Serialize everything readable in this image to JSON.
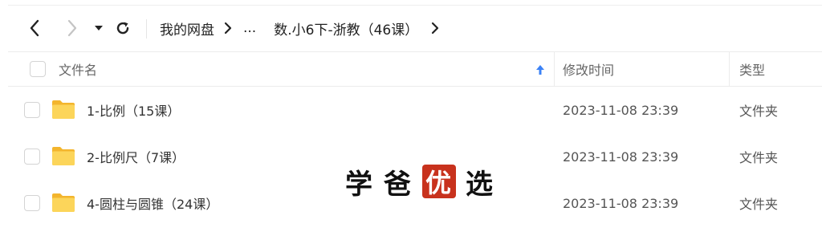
{
  "navbar": {
    "icons": {
      "back": "chevron-left-icon",
      "forward": "chevron-right-icon",
      "dropdown": "caret-down-icon",
      "refresh": "refresh-icon"
    },
    "breadcrumb": {
      "root": "我的网盘",
      "ellipsis": "...",
      "current": "数.小6下-浙教（46课）"
    }
  },
  "table": {
    "columns": {
      "name": "文件名",
      "modified": "修改时间",
      "type": "类型"
    },
    "sort_icon": "sort-ascending-arrow-icon",
    "sort_color": "#3b82f6",
    "folder_color": "#f7c244",
    "rows": [
      {
        "name": "1-比例（15课）",
        "modified": "2023-11-08 23:39",
        "type": "文件夹"
      },
      {
        "name": "2-比例尺（7课）",
        "modified": "2023-11-08 23:39",
        "type": "文件夹"
      },
      {
        "name": "4-圆柱与圆锥（24课）",
        "modified": "2023-11-08 23:39",
        "type": "文件夹"
      }
    ]
  },
  "watermark": {
    "char1": "学",
    "char2": "爸",
    "seal": "优",
    "char3": "选",
    "seal_color": "#c8321d"
  }
}
